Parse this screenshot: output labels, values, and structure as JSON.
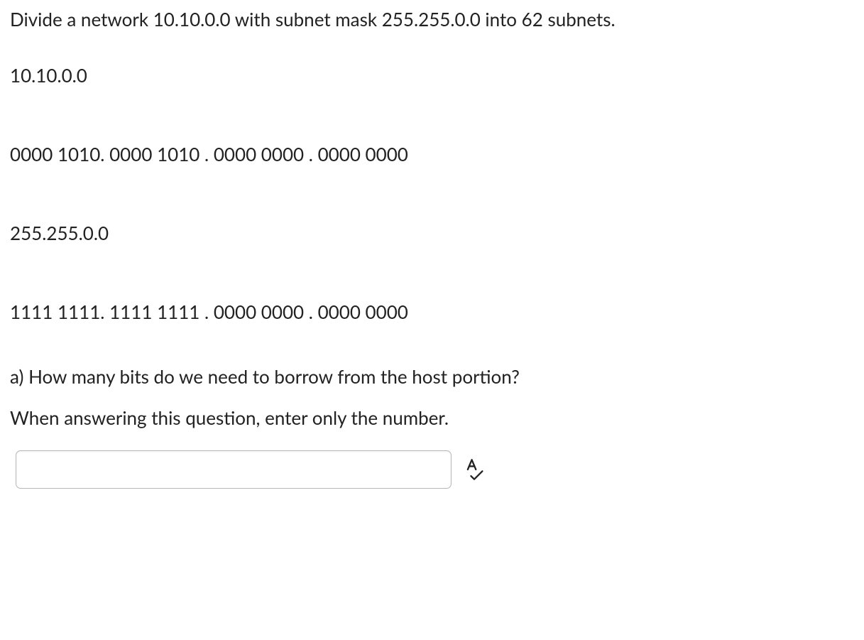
{
  "question": {
    "prompt": "Divide a network 10.10.0.0 with subnet mask 255.255.0.0 into 62 subnets.",
    "ip_decimal": "10.10.0.0",
    "ip_binary": "0000 1010. 0000 1010 . 0000 0000 . 0000 0000",
    "mask_decimal": "255.255.0.0",
    "mask_binary": "1111 1111. 1111 1111 . 0000 0000 . 0000 0000",
    "part_a": "a) How many bits do we need to borrow from the host portion?",
    "instruction": "When answering this question, enter only the number."
  },
  "answer": {
    "value": "",
    "placeholder": ""
  }
}
